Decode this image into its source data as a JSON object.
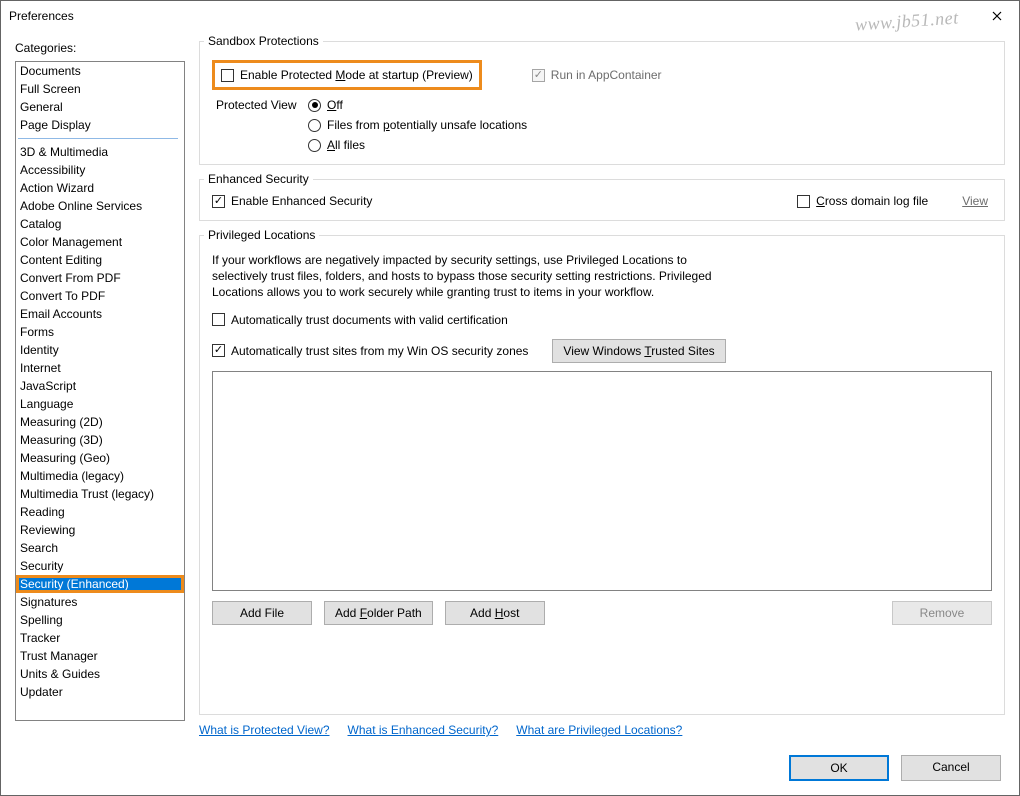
{
  "window": {
    "title": "Preferences"
  },
  "watermark": "www.jb51.net",
  "sidebar": {
    "label": "Categories:",
    "group1": [
      "Documents",
      "Full Screen",
      "General",
      "Page Display"
    ],
    "group2": [
      "3D & Multimedia",
      "Accessibility",
      "Action Wizard",
      "Adobe Online Services",
      "Catalog",
      "Color Management",
      "Content Editing",
      "Convert From PDF",
      "Convert To PDF",
      "Email Accounts",
      "Forms",
      "Identity",
      "Internet",
      "JavaScript",
      "Language",
      "Measuring (2D)",
      "Measuring (3D)",
      "Measuring (Geo)",
      "Multimedia (legacy)",
      "Multimedia Trust (legacy)",
      "Reading",
      "Reviewing",
      "Search",
      "Security",
      "Security (Enhanced)",
      "Signatures",
      "Spelling",
      "Tracker",
      "Trust Manager",
      "Units & Guides",
      "Updater"
    ],
    "selected": "Security (Enhanced)"
  },
  "sandbox": {
    "legend": "Sandbox Protections",
    "protected_mode_pre": "Enable Protected ",
    "protected_mode_u": "M",
    "protected_mode_post": "ode at startup (Preview)",
    "appcontainer": "Run in AppContainer",
    "pv_label": "Protected View",
    "pv_off_u": "O",
    "pv_off_post": "ff",
    "pv_unsafe_pre": "Files from ",
    "pv_unsafe_u": "p",
    "pv_unsafe_post": "otentially unsafe locations",
    "pv_all_u": "A",
    "pv_all_post": "ll files"
  },
  "enhanced": {
    "legend": "Enhanced Security",
    "enable": "Enable Enhanced Security",
    "cross_u": "C",
    "cross_post": "ross domain log file",
    "view_link": "View"
  },
  "privileged": {
    "legend": "Privileged Locations",
    "desc": "If your workflows are negatively impacted by security settings, use Privileged Locations to selectively trust files, folders, and hosts to bypass those security setting restrictions. Privileged Locations allows you to work securely while granting trust to items in your workflow.",
    "auto_cert": "Automatically trust documents with valid certification",
    "auto_zones": "Automatically trust sites from my Win OS security zones",
    "view_trusted_pre": "View Windows ",
    "view_trusted_u": "T",
    "view_trusted_post": "rusted Sites",
    "add_file": "Add File",
    "add_folder_pre": "Add ",
    "add_folder_u": "F",
    "add_folder_post": "older Path",
    "add_host_pre": "Add ",
    "add_host_u": "H",
    "add_host_post": "ost",
    "remove": "Remove"
  },
  "help": {
    "pv": "What is Protected View?",
    "es": "What is Enhanced Security?",
    "pl": "What are Privileged Locations?"
  },
  "buttons": {
    "ok": "OK",
    "cancel": "Cancel"
  }
}
